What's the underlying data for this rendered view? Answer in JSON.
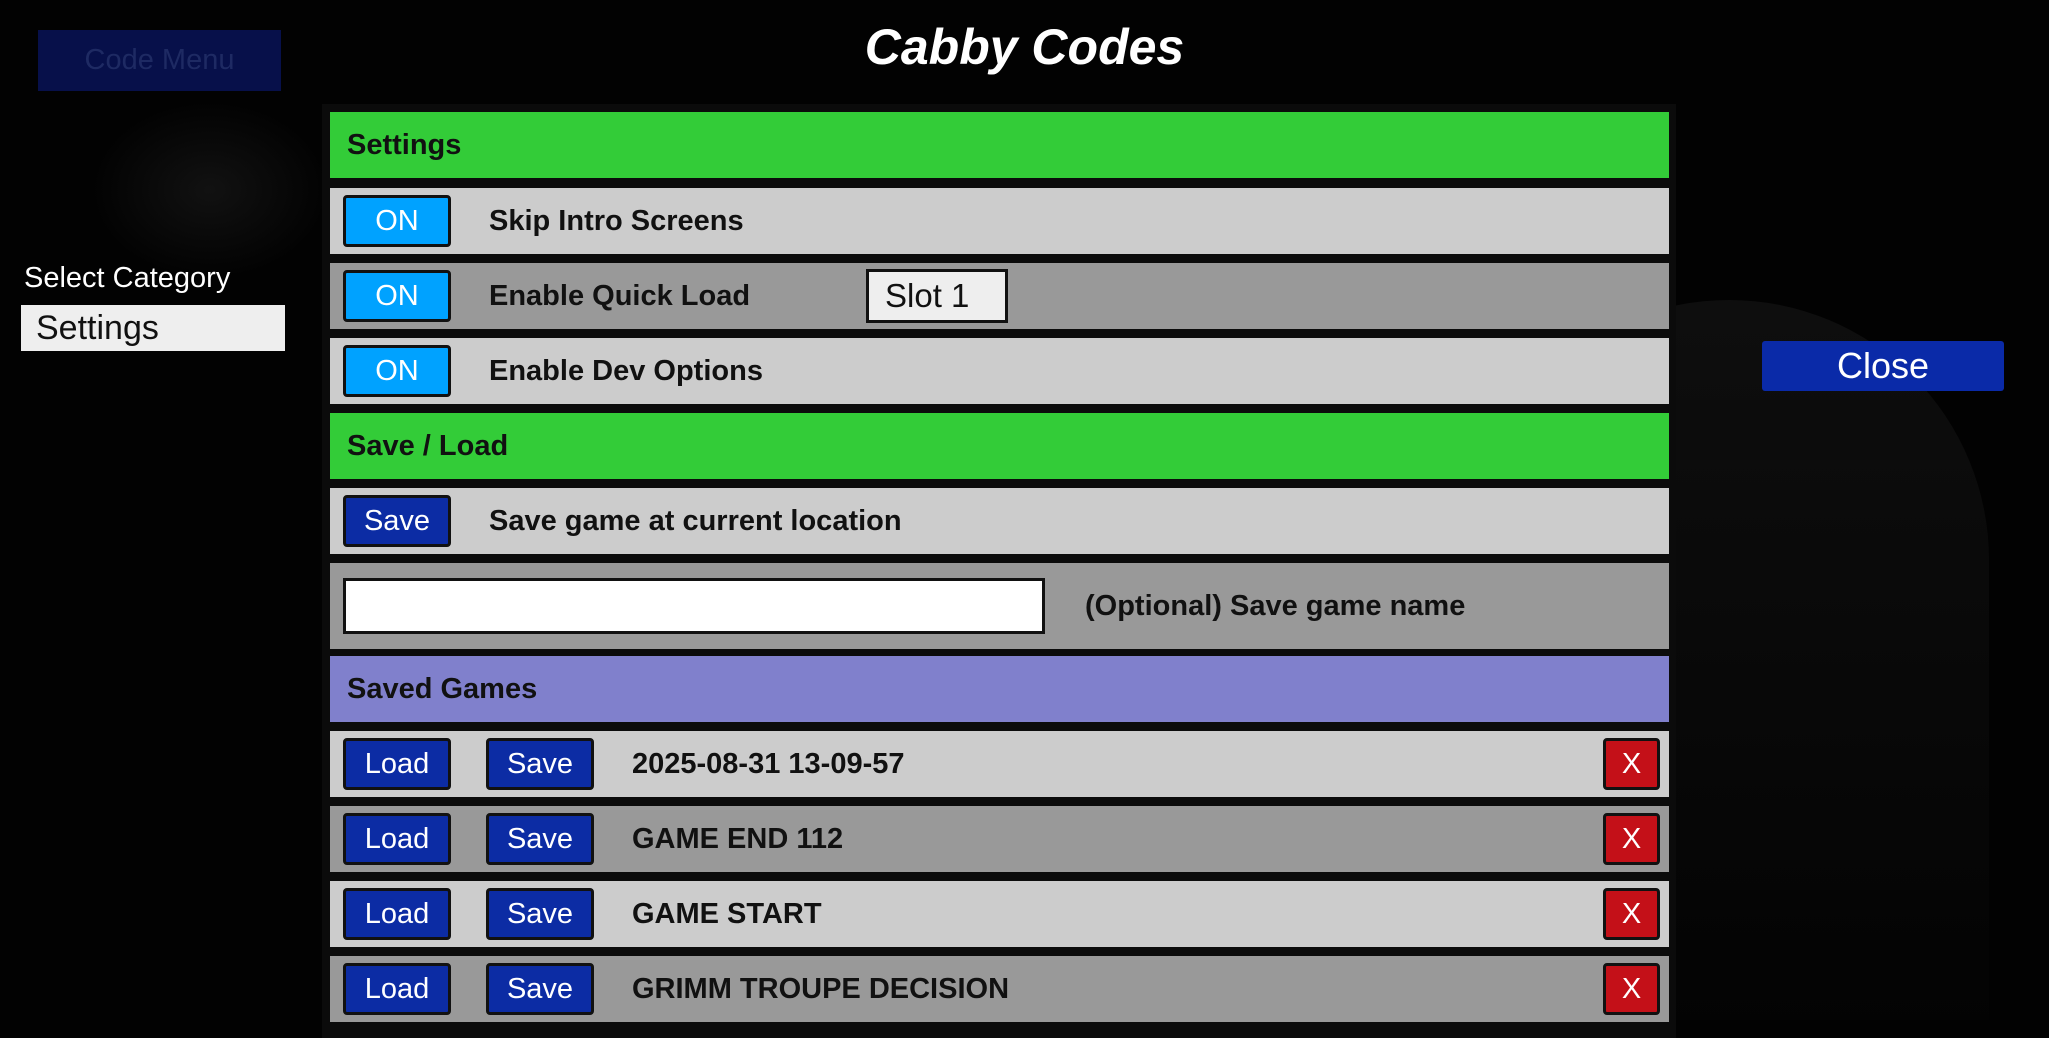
{
  "app": {
    "title": "Cabby Codes",
    "code_menu_label": "Code Menu",
    "close_label": "Close"
  },
  "sidebar": {
    "select_category_label": "Select Category",
    "selected_category": "Settings"
  },
  "sections": {
    "settings": {
      "header": "Settings",
      "rows": [
        {
          "toggle": "ON",
          "label": "Skip Intro Screens"
        },
        {
          "toggle": "ON",
          "label": "Enable Quick Load",
          "slot": "Slot 1"
        },
        {
          "toggle": "ON",
          "label": "Enable Dev Options"
        }
      ]
    },
    "save_load": {
      "header": "Save / Load",
      "save_button": "Save",
      "save_label": "Save game at current location",
      "name_input_value": "",
      "name_input_hint": "(Optional) Save game name"
    },
    "saved_games": {
      "header": "Saved Games",
      "load_label": "Load",
      "save_label": "Save",
      "delete_label": "X",
      "items": [
        {
          "name": "2025-08-31 13-09-57"
        },
        {
          "name": "GAME END 112"
        },
        {
          "name": "GAME START"
        },
        {
          "name": "GRIMM TROUPE DECISION"
        }
      ]
    }
  },
  "colors": {
    "section_header": "#33cc38",
    "saved_games_header": "#8080cc",
    "toggle_on": "#00a2ff",
    "action_button": "#0c2ca4",
    "delete_button": "#c41018",
    "row_light": "#cccccc",
    "row_dark": "#999999"
  }
}
